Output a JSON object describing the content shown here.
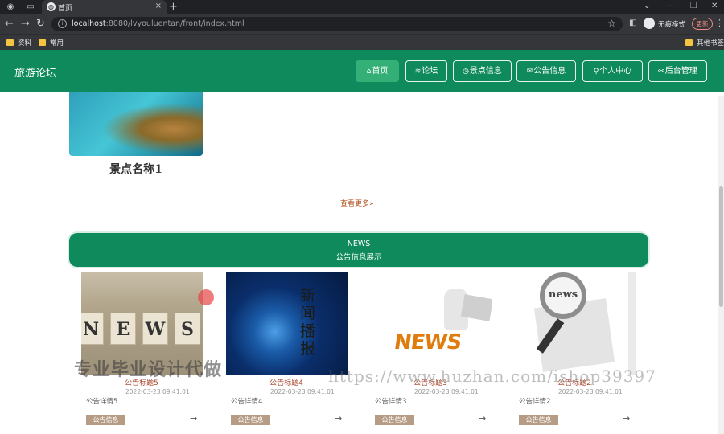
{
  "browser": {
    "tab_title": "首页",
    "url_host": "localhost",
    "url_rest": ":8080/lvyouluentan/front/index.html",
    "incognito_label": "无痕模式",
    "update_label": "更新",
    "bookmarks": [
      "资料",
      "常用"
    ],
    "other_bookmarks": "其他书签"
  },
  "header": {
    "brand": "旅游论坛",
    "nav": [
      {
        "label": "首页",
        "icon": "home-icon",
        "glyph": "⌂",
        "active": true
      },
      {
        "label": "论坛",
        "icon": "layers-icon",
        "glyph": "≋",
        "active": false
      },
      {
        "label": "景点信息",
        "icon": "clock-icon",
        "glyph": "◷",
        "active": false
      },
      {
        "label": "公告信息",
        "icon": "mail-icon",
        "glyph": "✉",
        "active": false
      },
      {
        "label": "个人中心",
        "icon": "user-icon",
        "glyph": "⚲",
        "active": false
      },
      {
        "label": "后台管理",
        "icon": "link-icon",
        "glyph": "⚯",
        "active": false
      }
    ]
  },
  "scenic": {
    "name": "景点名称1",
    "more": "查看更多"
  },
  "news": {
    "banner_en": "NEWS",
    "banner_cn": "公告信息展示",
    "items": [
      {
        "title": "公告标题5",
        "date": "2022-03-23 09:41:01",
        "desc": "公告详情5",
        "tag": "公告信息"
      },
      {
        "title": "公告标题4",
        "date": "2022-03-23 09:41:01",
        "desc": "公告详情4",
        "tag": "公告信息"
      },
      {
        "title": "公告标题3",
        "date": "2022-03-23 09:41:01",
        "desc": "公告详情3",
        "tag": "公告信息"
      },
      {
        "title": "公告标题2",
        "date": "2022-03-23 09:41:01",
        "desc": "公告详情2",
        "tag": "公告信息"
      }
    ],
    "img1_letters": [
      "N",
      "E",
      "W",
      "S"
    ],
    "img2_text": "新闻播报",
    "img3_word": "NEWS",
    "img4_word": "news"
  },
  "watermark": {
    "left": "专业毕业设计代做",
    "right": "https://www.huzhan.com/ishop39397"
  }
}
